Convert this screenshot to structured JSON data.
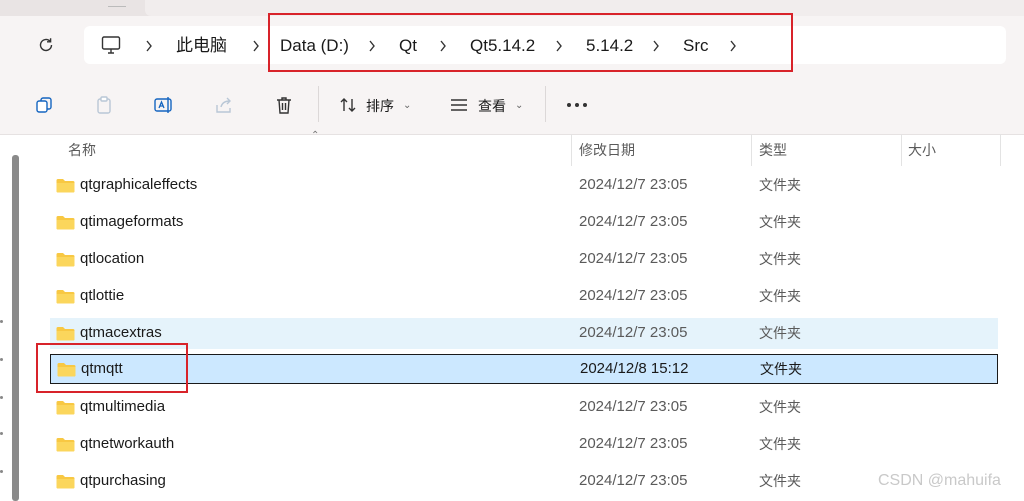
{
  "address": {
    "root": "此电脑",
    "crumbs": [
      "Data (D:)",
      "Qt",
      "Qt5.14.2",
      "5.14.2",
      "Src"
    ]
  },
  "toolbar": {
    "sort_label": "排序",
    "view_label": "查看"
  },
  "columns": {
    "name": "名称",
    "modified": "修改日期",
    "type": "类型",
    "size": "大小"
  },
  "files": [
    {
      "name": "qtgraphicaleffects",
      "modified": "2024/12/7 23:05",
      "type": "文件夹"
    },
    {
      "name": "qtimageformats",
      "modified": "2024/12/7 23:05",
      "type": "文件夹"
    },
    {
      "name": "qtlocation",
      "modified": "2024/12/7 23:05",
      "type": "文件夹"
    },
    {
      "name": "qtlottie",
      "modified": "2024/12/7 23:05",
      "type": "文件夹"
    },
    {
      "name": "qtmacextras",
      "modified": "2024/12/7 23:05",
      "type": "文件夹",
      "state": "hover"
    },
    {
      "name": "qtmqtt",
      "modified": "2024/12/8 15:12",
      "type": "文件夹",
      "state": "selected"
    },
    {
      "name": "qtmultimedia",
      "modified": "2024/12/7 23:05",
      "type": "文件夹"
    },
    {
      "name": "qtnetworkauth",
      "modified": "2024/12/7 23:05",
      "type": "文件夹"
    },
    {
      "name": "qtpurchasing",
      "modified": "2024/12/7 23:05",
      "type": "文件夹"
    }
  ],
  "watermark": "CSDN @mahuifa",
  "colors": {
    "selected_bg": "#cce8ff",
    "hover_bg": "#e5f3fb",
    "annotation_red": "#d8232a",
    "folder_yellow": "#f8c843"
  }
}
